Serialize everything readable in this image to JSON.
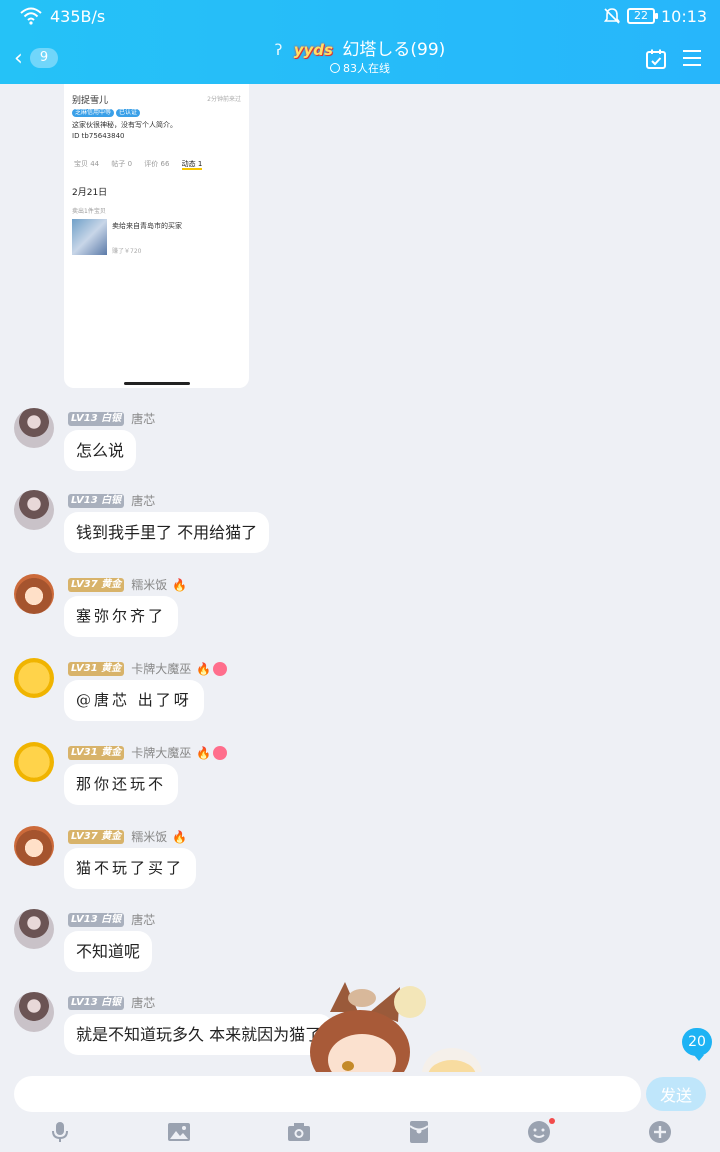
{
  "status_bar": {
    "net_speed": "435B/s",
    "battery": "22",
    "time": "10:13"
  },
  "nav": {
    "back_count": "9",
    "group_badge": "yyds",
    "title": "幻塔しる(99)",
    "online": "83人在线"
  },
  "shared_card": {
    "name": "别捉雪儿",
    "ago": "2分钟前来过",
    "tags": [
      "芝麻信用中等",
      "已认证"
    ],
    "bio": "这家伙很神秘，没有写个人简介。",
    "uid": "ID  tb75643840",
    "tabs": [
      "宝贝 44",
      "帖子 0",
      "评价 66",
      "动态 1"
    ],
    "date": "2月21日",
    "sold_label": "卖出1件宝贝",
    "sell_text": "卖给来自青岛市的买家",
    "earn_text": "赚了￥720"
  },
  "messages": [
    {
      "level": "LV13",
      "rank": "白银",
      "name": "唐芯",
      "text": "怎么说"
    },
    {
      "level": "LV13",
      "rank": "白银",
      "name": "唐芯",
      "text": "钱到我手里了 不用给猫了"
    },
    {
      "level": "LV37",
      "rank": "黄金",
      "name": "糯米饭",
      "text": "塞弥尔齐了"
    },
    {
      "level": "LV31",
      "rank": "黄金",
      "name": "卡牌大魔巫",
      "text": "@唐芯 出了呀"
    },
    {
      "level": "LV31",
      "rank": "黄金",
      "name": "卡牌大魔巫",
      "text": "那你还玩不"
    },
    {
      "level": "LV37",
      "rank": "黄金",
      "name": "糯米饭",
      "text": "猫不玩了买了"
    },
    {
      "level": "LV13",
      "rank": "白银",
      "name": "唐芯",
      "text": "不知道呢"
    },
    {
      "level": "LV13",
      "rank": "白银",
      "name": "唐芯",
      "text": "就是不知道玩多久 本来就因为猫了"
    }
  ],
  "unread_count": "20",
  "input": {
    "placeholder": "",
    "send_label": "发送"
  },
  "toolbar_icons": [
    "mic-icon",
    "image-icon",
    "camera-icon",
    "red-packet-icon",
    "emoji-icon",
    "plus-icon"
  ],
  "colors": {
    "header": "#25c2f7",
    "background": "#eef0f5",
    "send_disabled": "#bfe6fb"
  }
}
